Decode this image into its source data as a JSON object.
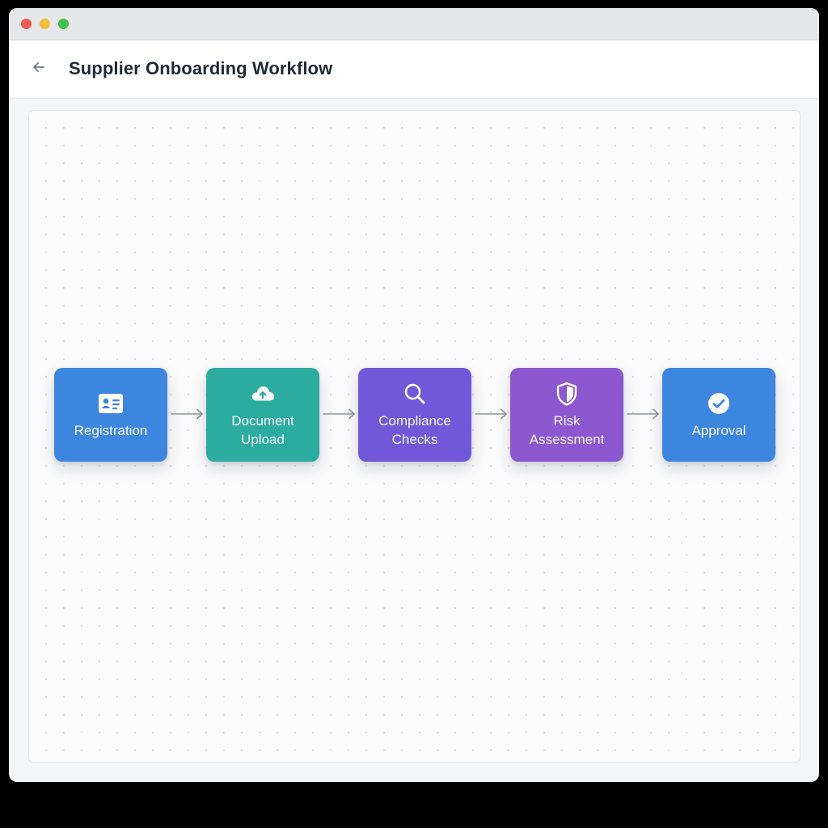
{
  "window": {
    "controls": [
      "close",
      "minimize",
      "maximize"
    ]
  },
  "header": {
    "back_icon": "arrow-left-icon",
    "title": "Supplier Onboarding Workflow"
  },
  "workflow": {
    "steps": [
      {
        "label": "Registration",
        "icon": "id-card-icon",
        "color": "#3d86df"
      },
      {
        "label": "Document\nUpload",
        "icon": "cloud-upload-icon",
        "color": "#2cab9f"
      },
      {
        "label": "Compliance\nChecks",
        "icon": "search-icon",
        "color": "#7058d8"
      },
      {
        "label": "Risk\nAssessment",
        "icon": "shield-icon",
        "color": "#8c57cf"
      },
      {
        "label": "Approval",
        "icon": "check-circle-icon",
        "color": "#3d86df"
      }
    ]
  }
}
